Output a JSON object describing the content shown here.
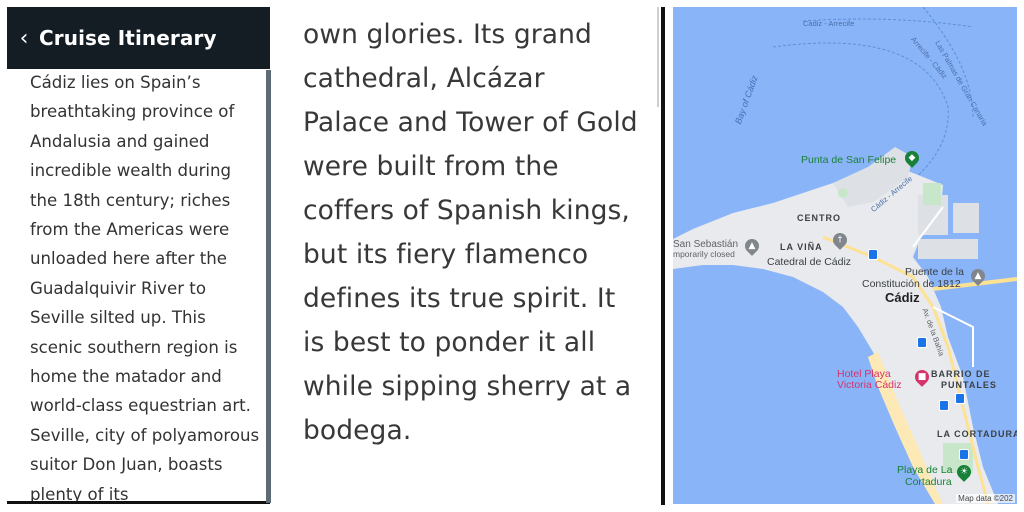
{
  "header": {
    "title": "Cruise Itinerary",
    "back_icon": "chevron-left-icon"
  },
  "left_text": "Cádiz lies on Spain’s breathtaking province of Andalusia and gained incredible wealth during the 18th century; riches from the Americas were unloaded here after the Guadalquivir River to Seville silted up. This scenic southern region is home the matador and world-class equestrian art. Seville, city of polyamorous suitor Don Juan, boasts plenty of its",
  "middle_text": "own glories. Its grand cathedral, Alcázar Palace and Tower of Gold were built from the coffers of Spanish kings, but its fiery flamenco defines its true spirit. It is best to ponder it all while sipping sherry at a bodega.",
  "map": {
    "labels": {
      "road_top": "Cádiz - Arrecife",
      "road_palmas": "Las Palmas de Gran Canaria",
      "road_arrecife": "Arrecife - Cádiz",
      "bay": "Bay of Cádiz",
      "punta": "Punta de San Felipe",
      "road_port": "Cádiz - Arrecife",
      "centro": "CENTRO",
      "sebastian": "San Sebastián",
      "sebastian_note": "mporarily closed",
      "la_vina": "LA VIÑA",
      "catedral": "Catedral de Cádiz",
      "puente": "Puente de la",
      "puente2": "Constitución de 1812",
      "cadiz": "Cádiz",
      "avenida": "Av. de la Bahía",
      "hotel": "Hotel Playa",
      "hotel2": "Victoria Cádiz",
      "barrio": "BARRIO DE",
      "barrio2": "PUNTALES",
      "cortadura_area": "LA CORTADURA",
      "playa": "Playa de La",
      "playa2": "Cortadura",
      "credit": "Map data ©202"
    },
    "colors": {
      "water": "#8ab4f8",
      "land": "#e8eaed",
      "park": "#c8e6c9",
      "road": "#fde293",
      "pink": "#d6336c",
      "green": "#188038"
    }
  }
}
